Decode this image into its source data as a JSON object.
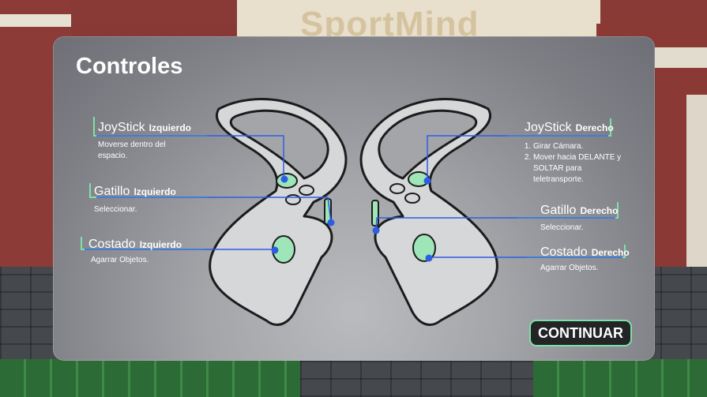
{
  "background": {
    "sign_text": "SportMind"
  },
  "panel": {
    "title": "Controles",
    "labels": {
      "left_joystick": {
        "main": "JoyStick",
        "sub": "Izquierdo",
        "desc": "Moverse dentro del espacio."
      },
      "left_trigger": {
        "main": "Gatillo",
        "sub": "Izquierdo",
        "desc": "Seleccionar."
      },
      "left_grip": {
        "main": "Costado",
        "sub": "Izquierdo",
        "desc": "Agarrar Objetos."
      },
      "right_joystick": {
        "main": "JoyStick",
        "sub": "Derecho",
        "desc_items": [
          "Girar Cámara.",
          "Mover hacia DELANTE y SOLTAR para teletransporte."
        ]
      },
      "right_trigger": {
        "main": "Gatillo",
        "sub": "Derecho",
        "desc": "Seleccionar."
      },
      "right_grip": {
        "main": "Costado",
        "sub": "Derecho",
        "desc": "Agarrar Objetos."
      }
    },
    "continue_button": "CONTINUAR"
  },
  "colors": {
    "accent_green": "#7fe0a8",
    "pointer_blue": "#2f5ce6",
    "button_bg": "#222426"
  }
}
